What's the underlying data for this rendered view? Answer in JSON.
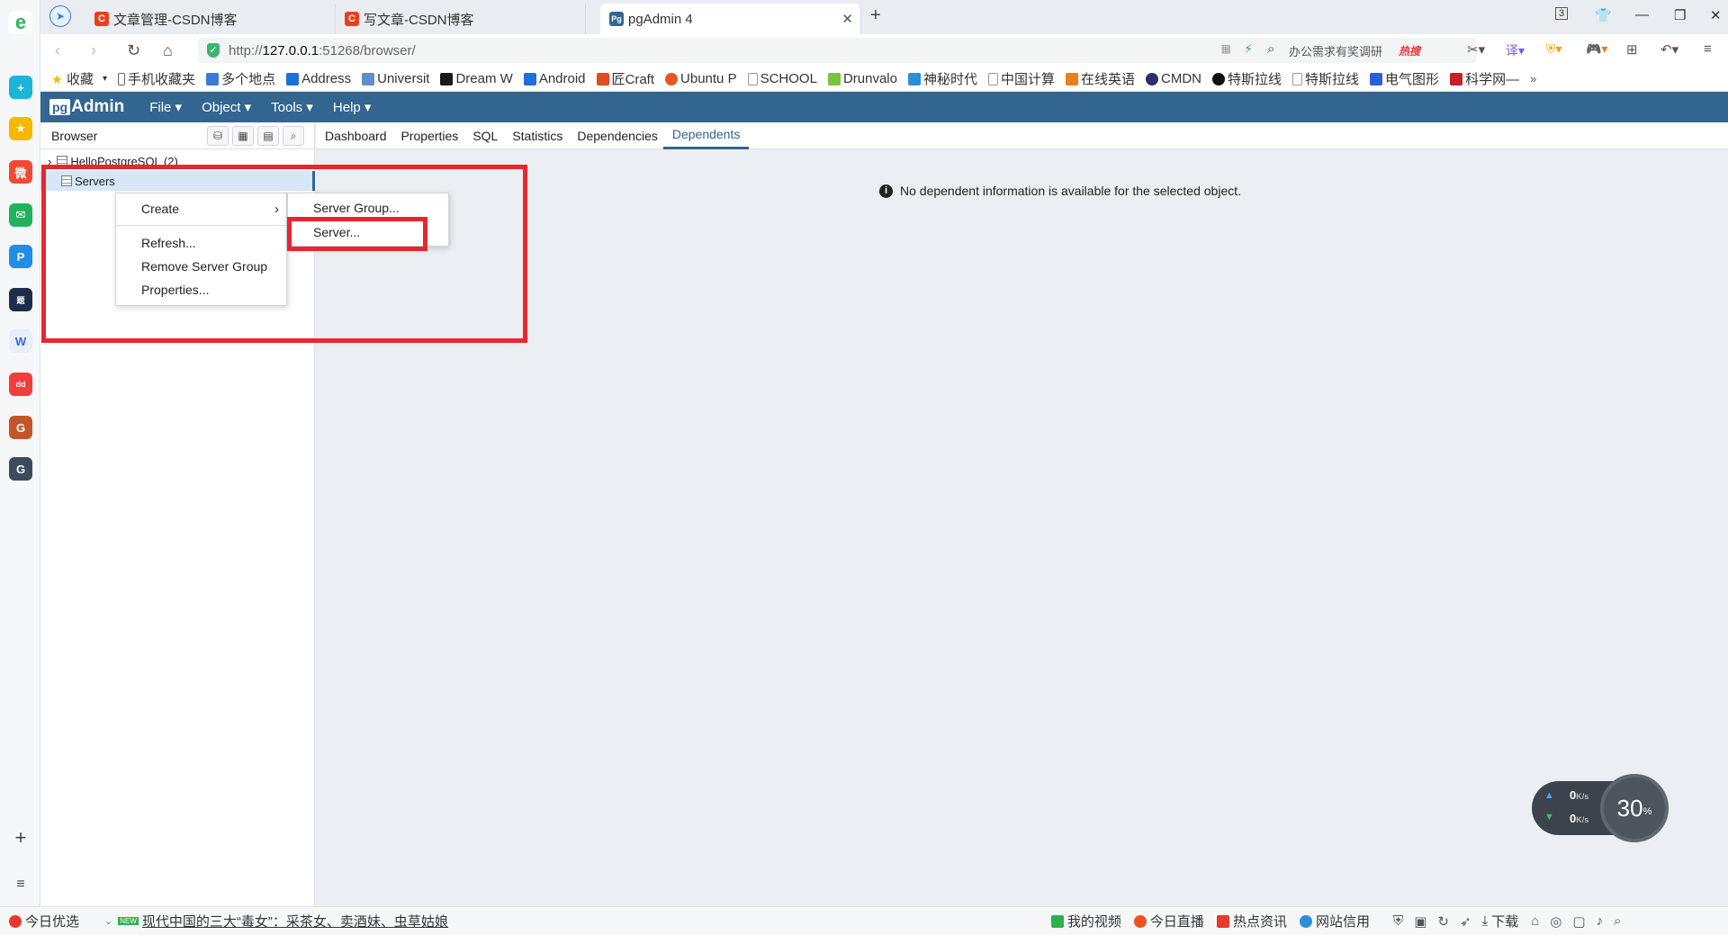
{
  "browser": {
    "tabs": [
      {
        "title": "文章管理-CSDN博客",
        "favicon": "C",
        "color": "#e8401c"
      },
      {
        "title": "写文章-CSDN博客",
        "favicon": "C",
        "color": "#e8401c"
      },
      {
        "title": "pgAdmin 4",
        "favicon": "Pg",
        "color": "#326690"
      }
    ],
    "url_prefix": "http://",
    "url_host": "127.0.0.1",
    "url_rest": ":51268/browser/",
    "search_text": "办公需求有奖调研",
    "hot_label": "热搜",
    "window_badge": "3",
    "bookmarks": [
      "收藏",
      "手机收藏夹",
      "多个地点",
      "Address",
      "Universit",
      "Dream W",
      "Android",
      "匠Craft",
      "Ubuntu P",
      "SCHOOL",
      "Drunvalo",
      "神秘时代",
      "中国计算",
      "在线英语",
      "CMDN",
      "特斯拉线",
      "特斯拉线",
      "电气图形",
      "科学网—"
    ]
  },
  "pgadmin": {
    "logo_prefix": "pg",
    "logo_text": "Admin",
    "menus": [
      "File",
      "Object",
      "Tools",
      "Help"
    ],
    "browser_title": "Browser",
    "tree": [
      {
        "label": "HelloPostgreSQL (2)"
      },
      {
        "label": "Servers"
      }
    ],
    "panel_tabs": [
      "Dashboard",
      "Properties",
      "SQL",
      "Statistics",
      "Dependencies",
      "Dependents"
    ],
    "active_tab": "Dependents",
    "info_message": "No dependent information is available for the selected object."
  },
  "context_menu": {
    "items": [
      "Create",
      "Refresh...",
      "Remove Server Group",
      "Properties..."
    ],
    "submenu": [
      "Server Group...",
      "Server..."
    ]
  },
  "speed_widget": {
    "up": "0",
    "down": "0",
    "unit": "K/s",
    "percent": "30",
    "percent_sign": "%"
  },
  "statusbar": {
    "left": "今日优选",
    "news_badge": "NEW",
    "headline": "现代中国的三大“毒女”：采茶女、卖酒妹、虫草姑娘",
    "right_items": [
      "我的视频",
      "今日直播",
      "热点资讯",
      "网站信用"
    ],
    "download": "下载"
  }
}
